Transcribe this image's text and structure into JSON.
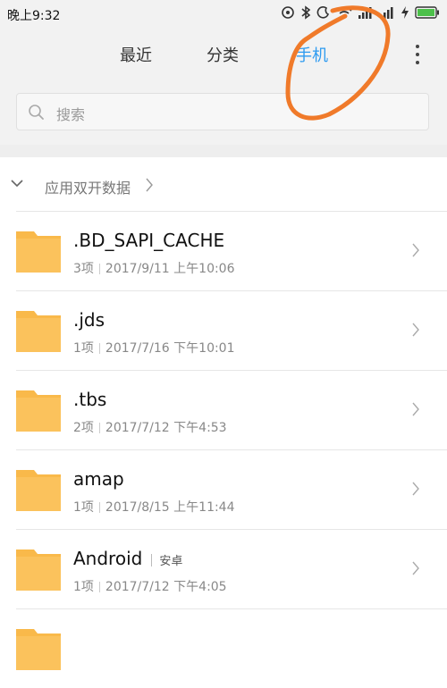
{
  "status_bar": {
    "time": "晚上9:32",
    "icons": [
      "alarm-icon",
      "bluetooth-icon",
      "do-not-disturb-icon",
      "wifi-icon",
      "signal-icon",
      "signal-icon",
      "flash-icon",
      "battery-icon"
    ]
  },
  "tabs": [
    {
      "label": "最近",
      "active": false
    },
    {
      "label": "分类",
      "active": false
    },
    {
      "label": "手机",
      "active": true
    }
  ],
  "search": {
    "placeholder": "搜索"
  },
  "section": {
    "label": "应用双开数据"
  },
  "files": [
    {
      "name": ".BD_SAPI_CACHE",
      "tag": "",
      "count": "3项",
      "date": "2017/9/11 上午10:06"
    },
    {
      "name": ".jds",
      "tag": "",
      "count": "1项",
      "date": "2017/7/16 下午10:01"
    },
    {
      "name": ".tbs",
      "tag": "",
      "count": "2项",
      "date": "2017/7/12 下午4:53"
    },
    {
      "name": "amap",
      "tag": "",
      "count": "1项",
      "date": "2017/8/15 上午11:44"
    },
    {
      "name": "Android",
      "tag": "安卓",
      "count": "1项",
      "date": "2017/7/12 下午4:05"
    }
  ],
  "colors": {
    "accent": "#2e9bf0",
    "folder": "#f9b94a",
    "annotation": "#f07a2a"
  }
}
